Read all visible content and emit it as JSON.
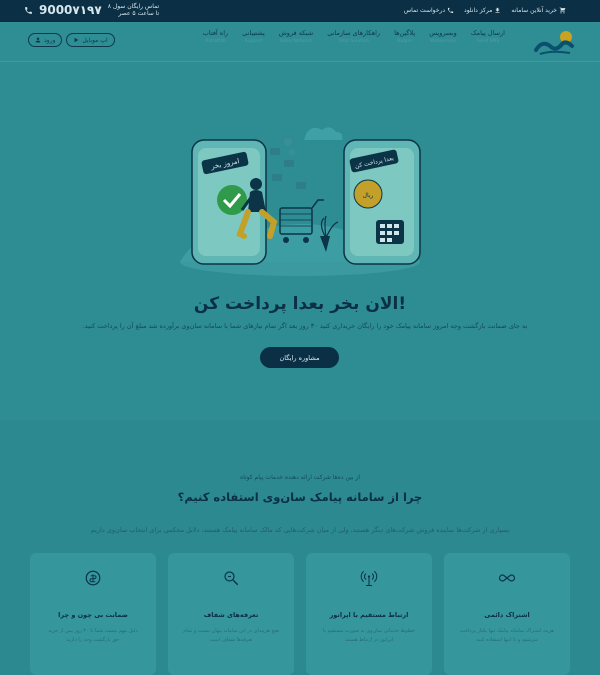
{
  "topbar": {
    "phone": "9000۷۱۹۷",
    "hours_line1": "تماس رایگان سول ۸",
    "hours_line2": "تا ساعت ۵ عصر",
    "links": [
      {
        "label": "خرید آنلاین سامانه",
        "icon": "cart-icon"
      },
      {
        "label": "مرکز دانلود",
        "icon": "download-icon"
      },
      {
        "label": "درخواست تماس",
        "icon": "phone-icon"
      }
    ]
  },
  "nav": {
    "items": [
      {
        "label": "ارسال پیامک",
        "sub": "Send SMS",
        "caret": true
      },
      {
        "label": "وبسرویس",
        "sub": "Webservice",
        "caret": true
      },
      {
        "label": "پلاگین‌ها",
        "sub": "Plugins",
        "caret": true
      },
      {
        "label": "راهکارهای سازمانی",
        "sub": "Total Solution",
        "caret": false
      },
      {
        "label": "شبکه فروش",
        "sub": "Sales Network",
        "caret": false
      },
      {
        "label": "پشتیبانی",
        "sub": "Support",
        "caret": false
      },
      {
        "label": "راه آفتاب",
        "sub": "Rahaftab",
        "caret": false
      }
    ],
    "mobile_button": "اپ موبایل",
    "login_button": "ورود"
  },
  "hero": {
    "title": "الان بخر بعدا پرداخت کن!",
    "description": "به جای ضمانت بازگشت وجه امروز سامانه پیامک خود را رایگان خریداری کنید ۳۰ روز بعد اگر تمام نیازهای شما با سامانه سان‌وی برآورده شد مبلغ آن را پرداخت کنید.",
    "cta": "مشاوره رایگان",
    "phone_left_label": "امروز بخر",
    "phone_right_label": "بعدا پرداخت کن",
    "coin_label": "ریال"
  },
  "why": {
    "kicker": "از بین ده‌ها شرکت ارائه دهنده خدمات پیام کوتاه",
    "title": "چرا از سامانه پیامک سان‌وی استفاده کنیم؟",
    "description": "بسیاری از شرکت‌ها نماینده فروش شرکت‌های دیگر هستند، ولی از میان شرکت‌هایی که مالک سامانه پیامک هستند، دلایل محکمی برای انتخاب سان‌وی داریم",
    "cards": [
      {
        "icon": "infinity-icon",
        "title": "اشتراک دائمی",
        "text": "هزینه اشتراک سامانه پیامک تنها یکبار پرداخت می‌شود و تا انتها استفاده کنید"
      },
      {
        "icon": "antenna-icon",
        "title": "ارتباط مستقیم با اپراتور",
        "text": "خطوط خدماتی سان‌وی به صورت مستقیم با اپراتور در ارتباط هستند"
      },
      {
        "icon": "magnifier-icon",
        "title": "تعرفه‌های شفاف",
        "text": "هیچ هزینه‌ای در این سامانه پنهان نیست و تمام تعرفه‌ها شفاف است"
      },
      {
        "icon": "money-back-icon",
        "title": "ضمانت بی چون و چرا",
        "text": "دلیل مهم نیست شما تا ۳۰ روز پس از خرید حق بازگشت وجه را دارید"
      }
    ]
  }
}
